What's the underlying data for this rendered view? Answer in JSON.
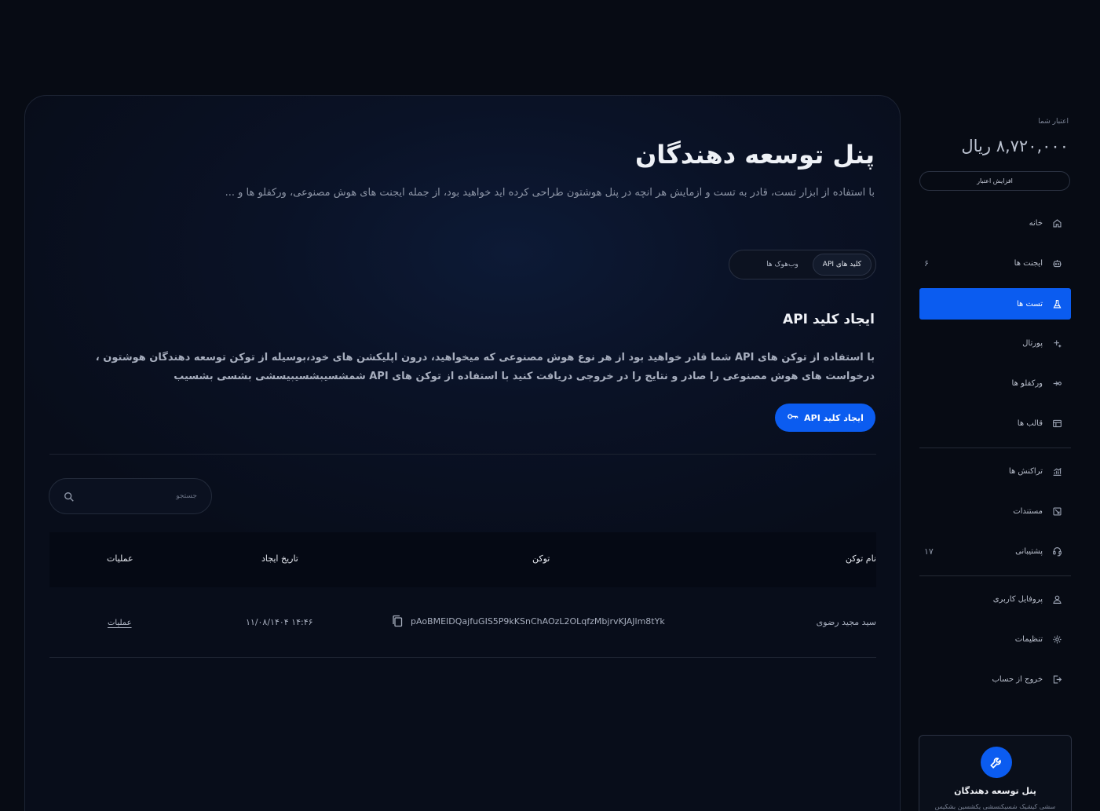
{
  "sidebar": {
    "credit_label": "اعتبار شما",
    "credit_amount": "۸,۷۲۰,۰۰۰ ریال",
    "increase_credit": "افزایش اعتبار",
    "items": [
      {
        "label": "خانه",
        "icon": "home-icon"
      },
      {
        "label": "ایجنت ها",
        "icon": "robot-icon",
        "badge": "۶"
      },
      {
        "label": "تست ها",
        "icon": "flask-icon",
        "active": true
      },
      {
        "label": "پورتال",
        "icon": "sparkle-icon"
      },
      {
        "label": "ورکفلو ها",
        "icon": "workflow-icon"
      },
      {
        "label": "قالب ها",
        "icon": "template-icon"
      },
      {
        "label": "تراکنش ها",
        "icon": "chart-icon"
      },
      {
        "label": "مستندات",
        "icon": "document-icon"
      },
      {
        "label": "پشتیبانی",
        "icon": "support-icon",
        "badge": "۱۷"
      },
      {
        "label": "پروفایل کاربری",
        "icon": "user-icon"
      },
      {
        "label": "تنظیمات",
        "icon": "gear-icon"
      },
      {
        "label": "خروج از حساب",
        "icon": "logout-icon"
      }
    ],
    "promo": {
      "title": "پنل توسعه دهندگان",
      "subtitle": "سشی کیشیک شسیکنسشی یکشسین بشکیس"
    }
  },
  "main": {
    "title": "پنل توسعه دهندگان",
    "description": "با استفاده از ابزار تست، قادر به تست و آزمایش هر آنچه در پنل هوشتون طراحی کرده اید خواهید بود، از جمله ایجنت های هوش مصنوعی، ورکفلو ها و ...",
    "tabs": [
      {
        "label": "کلید های API",
        "active": true
      },
      {
        "label": "وب‌هوک ها",
        "active": false
      }
    ],
    "section_title": "ایجاد کلید API",
    "section_desc": "با استفاده از توکن های API شما قادر خواهید بود از هر نوع هوش مصنوعی که میخواهید، درون اپلیکشن های خود،بوسیله از توکن توسعه دهندگان هوشتون ، درخواست های هوش مصنوعی را صادر و نتایج را در خروجی دریافت کنید با استفاده از توکن های API شمشسیبشسیبیسشی بشسی بشسیب",
    "create_button": "ایجاد کلید API",
    "search_placeholder": "جستجو",
    "table": {
      "columns": [
        "نام توکن",
        "توکن",
        "تاریخ ایجاد",
        "عملیات"
      ],
      "rows": [
        {
          "name": "سید مجید رضوی",
          "token": "pAoBMEIDQajfuGIS5P9kKSnChAOzL2OLqfzMbjrvKJAJlm8tYk",
          "date": "۱۱/۰۸/۱۴۰۴ ۱۴:۴۶",
          "action": "عملیات"
        }
      ]
    }
  },
  "colors": {
    "accent": "#0b5cf0",
    "background": "#070b14",
    "panel": "#0a1226"
  }
}
